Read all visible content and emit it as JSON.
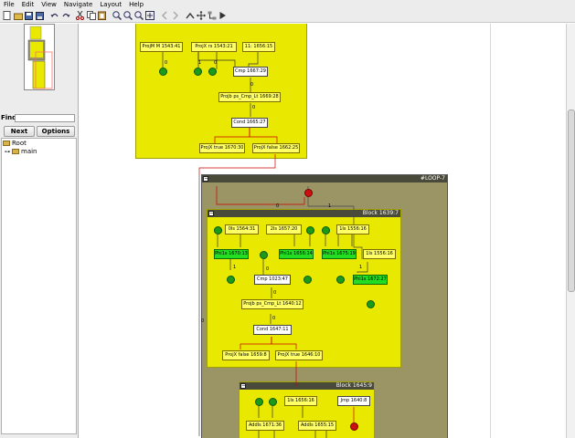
{
  "menu": [
    "File",
    "Edit",
    "View",
    "Navigate",
    "Layout",
    "Help"
  ],
  "toolbar_icons": [
    "new-icon",
    "open-icon",
    "save-icon",
    "save-all-icon",
    "undo-icon",
    "redo-icon",
    "cut-icon",
    "copy-icon",
    "paste-icon",
    "zoom-in-icon",
    "zoom-out-icon",
    "zoom-fit-icon",
    "zoom-reset-icon",
    "back-icon",
    "forward-icon",
    "up-icon",
    "move-icon",
    "layout-icon",
    "play-icon"
  ],
  "left": {
    "find_label": "Find:",
    "find_value": "",
    "next_label": "Next",
    "options_label": "Options",
    "tree": {
      "root": "Root",
      "child": "main"
    }
  },
  "graph": {
    "top_block": {
      "nodes": {
        "projm": "ProjM M 1543:41",
        "projx_rs": "ProjX rs 1543:21",
        "n11": "11: 1656:15",
        "cmp": "Cmp 1667:29",
        "projb": "Projb ps_Cmp_Lt 1669:28",
        "cond": "Cond 1665:27",
        "proj_true": "ProjX true 1670:30",
        "proj_false": "ProjX false 1662:25"
      }
    },
    "loop": {
      "title": "#LOOP-7",
      "edge_labels": [
        "0",
        "1",
        "0"
      ]
    },
    "block1639": {
      "title": "Block 1639:7",
      "nodes": {
        "c0": "0Is 1564:31",
        "c2": "2Is 1657:20",
        "c1": "1Is 1556:16",
        "phi1": "Phi1s 1670:13",
        "phi2": "Phi1s 1656:14",
        "phi3": "Phi1s 1675:19",
        "c1b": "1Is 1556:16",
        "phi4": "Phi1s 1672:27",
        "cmp": "Cmp 1023:47",
        "projb": "Projb ps_Cmp_Lt 1640:12",
        "cond": "Cond 1647:11",
        "proj_false": "ProjX false 1659:8",
        "proj_true": "ProjX true 1646:10"
      }
    },
    "block1645": {
      "title": "Block 1645:9",
      "nodes": {
        "c1": "1Is 1656:16",
        "jmp": "Jmp 1640:8",
        "add1": "AddIs 1671:36",
        "add2": "AddIs 1655:15"
      }
    }
  }
}
